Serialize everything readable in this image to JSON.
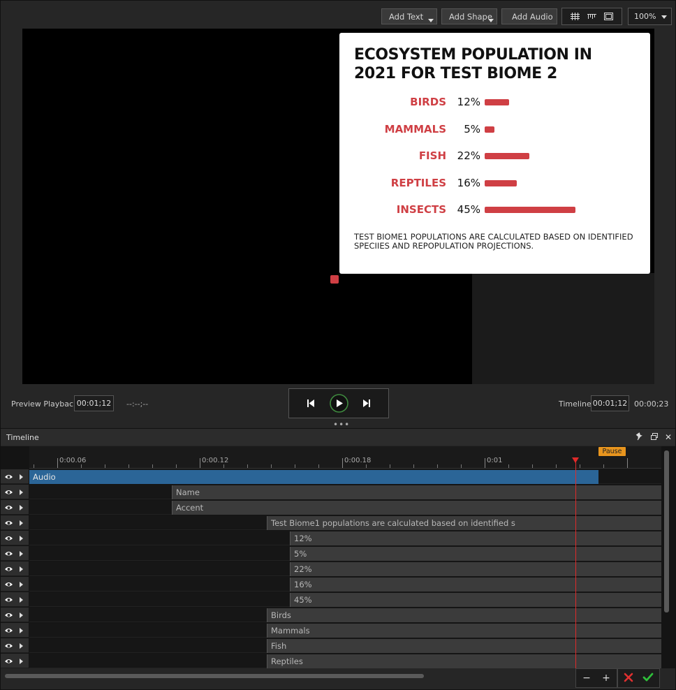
{
  "toolbar": {
    "add_text_label": "Add Text",
    "add_shape_label": "Add Shape",
    "add_audio_label": "Add Audio",
    "zoom_value": "100%",
    "view_icons": [
      "grid-icon",
      "ruler-icon",
      "safe-area-icon"
    ]
  },
  "card": {
    "title": "ECOSYSTEM POPULATION IN 2021 FOR TEST BIOME 2",
    "rows": [
      {
        "label": "BIRDS",
        "percent": "12%",
        "value": 12
      },
      {
        "label": "MAMMALS",
        "percent": "5%",
        "value": 5
      },
      {
        "label": "FISH",
        "percent": "22%",
        "value": 22
      },
      {
        "label": "REPTILES",
        "percent": "16%",
        "value": 16
      },
      {
        "label": "INSECTS",
        "percent": "45%",
        "value": 45
      }
    ],
    "footnote": "TEST BIOME1 POPULATIONS ARE CALCULATED BASED ON IDENTIFIED SPECIIES AND REPOPULATION PROJECTIONS.",
    "accent_color": "#cf3f44"
  },
  "playback": {
    "preview_label": "Preview Playback",
    "preview_time": "00:01;12",
    "preview_placeholder": "--:--;--",
    "timeline_label": "Timeline",
    "timeline_time": "00:01;12",
    "timeline_duration": "00:00;23"
  },
  "timeline": {
    "title": "Timeline",
    "pause_marker": "Pause",
    "ruler_labels": [
      "0:00.06",
      "0:00.12",
      "0:00.18",
      "0:01"
    ],
    "tracks": [
      {
        "name": "Audio"
      },
      {
        "name": "Name"
      },
      {
        "name": "Accent"
      },
      {
        "name": "Test Biome1 populations are calculated based on identified s"
      },
      {
        "name": "12%"
      },
      {
        "name": "5%"
      },
      {
        "name": "22%"
      },
      {
        "name": "16%"
      },
      {
        "name": "45%"
      },
      {
        "name": "Birds"
      },
      {
        "name": "Mammals"
      },
      {
        "name": "Fish"
      },
      {
        "name": "Reptiles"
      }
    ]
  },
  "bottom_controls": {
    "zoom_out": "−",
    "zoom_in": "+"
  }
}
